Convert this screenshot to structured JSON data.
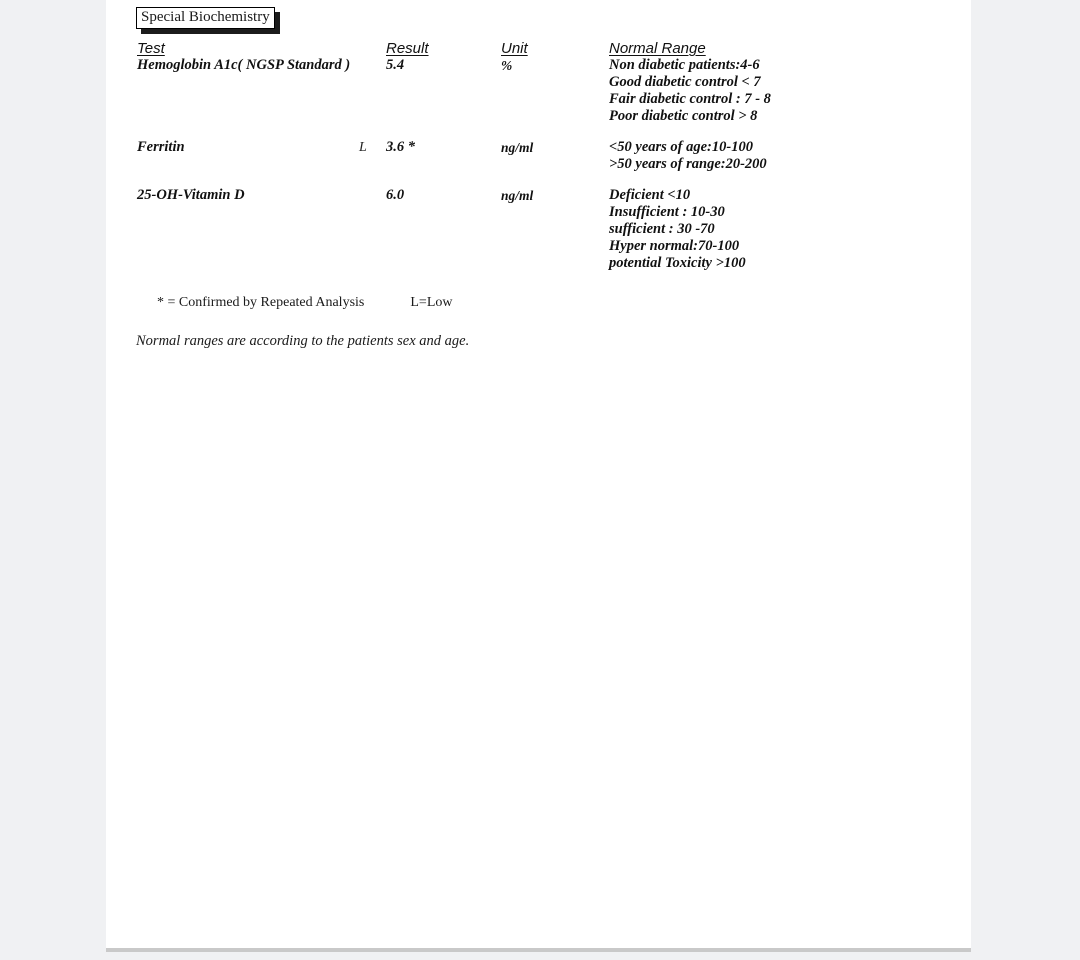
{
  "document": {
    "section_title": "Special Biochemistry"
  },
  "table": {
    "headers": {
      "test": "Test",
      "result": "Result",
      "unit": "Unit",
      "normal_range": "Normal Range"
    },
    "rows": [
      {
        "test": "Hemoglobin A1c( NGSP Standard )",
        "flag": "",
        "result": "5.4",
        "unit": "%",
        "normal_range": [
          "Non diabetic patients:4-6",
          "Good diabetic control < 7",
          "Fair diabetic control   : 7 - 8",
          "Poor diabetic control  > 8"
        ]
      },
      {
        "test": "Ferritin",
        "flag": "L",
        "result": "3.6 *",
        "unit": "ng/ml",
        "normal_range": [
          "<50 years of age:10-100",
          ">50 years of range:20-200"
        ]
      },
      {
        "test": "25-OH-Vitamin D",
        "flag": "",
        "result": "6.0",
        "unit": "ng/ml",
        "normal_range": [
          "Deficient <10",
          "Insufficient : 10-30",
          "sufficient : 30 -70",
          "Hyper normal:70-100",
          "potential Toxicity >100"
        ]
      }
    ]
  },
  "footnotes": {
    "asterisk_legend": "* = Confirmed by Repeated Analysis",
    "low_legend": "L=Low",
    "range_note": "Normal ranges are according to the patients sex and age."
  }
}
